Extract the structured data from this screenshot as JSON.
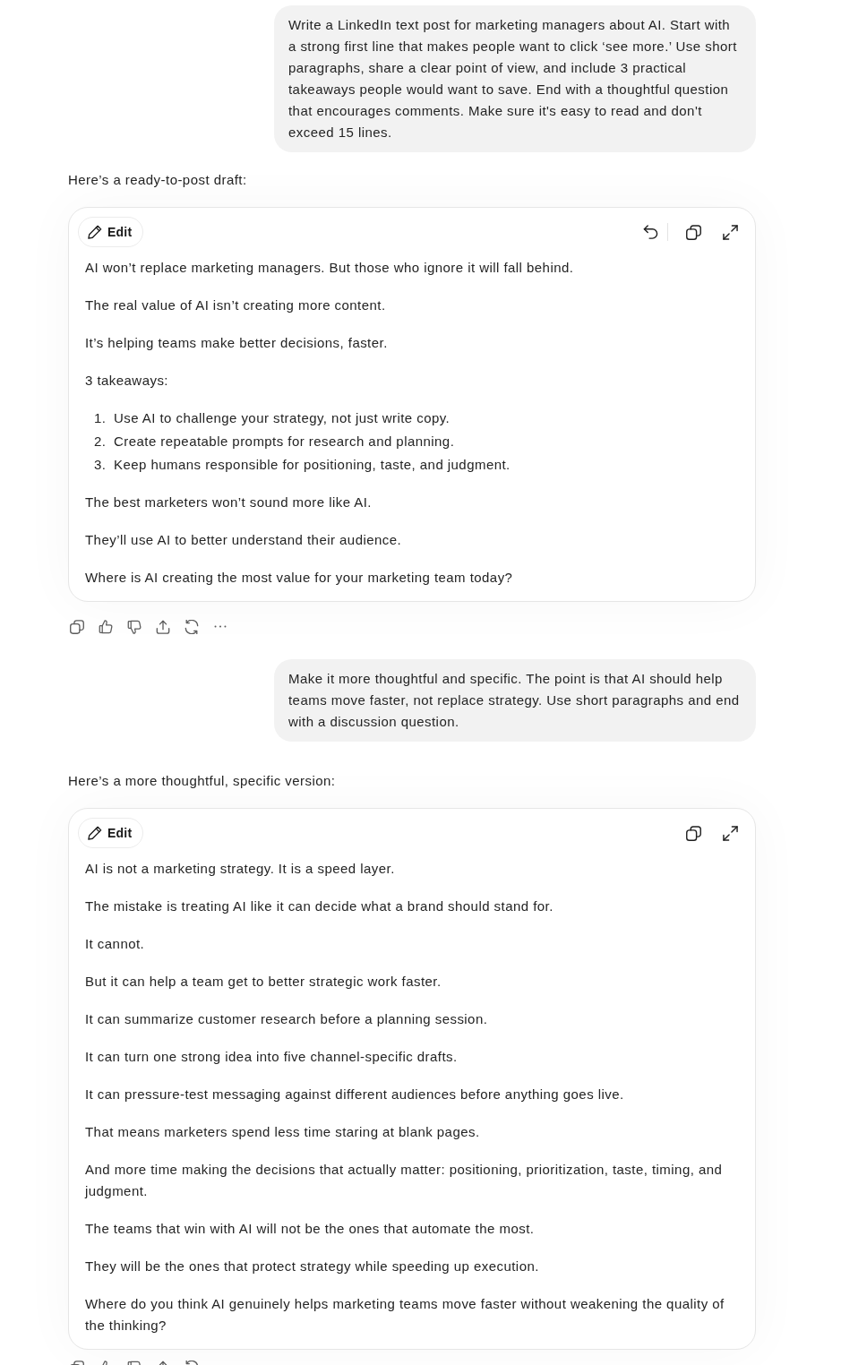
{
  "conversation": [
    {
      "kind": "user",
      "text": "Write a LinkedIn text post for marketing managers about AI. Start with a strong first line that makes people want to click ‘see more.’ Use short paragraphs, share a clear point of view, and include 3 practical takeaways people would want to save. End with a thoughtful question that encourages comments. Make sure it's easy to read and don't exceed 15 lines."
    },
    {
      "kind": "assistant",
      "intro": "Here’s a ready-to-post draft:",
      "draft": {
        "edit_label": "Edit",
        "undo_available": true,
        "blocks": [
          {
            "kind": "paragraph",
            "text": "AI won’t replace marketing managers. But those who ignore it will fall behind."
          },
          {
            "kind": "paragraph",
            "text": "The real value of AI isn’t creating more content."
          },
          {
            "kind": "paragraph",
            "text": "It’s helping teams make better decisions, faster."
          },
          {
            "kind": "paragraph",
            "text": "3 takeaways:"
          },
          {
            "kind": "numbered_list",
            "items": [
              {
                "number": "1.",
                "text": "Use AI to challenge your strategy, not just write copy."
              },
              {
                "number": "2.",
                "text": "Create repeatable prompts for research and planning."
              },
              {
                "number": "3.",
                "text": "Keep humans responsible for positioning, taste, and judgment."
              }
            ]
          },
          {
            "kind": "paragraph",
            "text": "The best marketers won’t sound more like AI."
          },
          {
            "kind": "paragraph",
            "text": "They’ll use AI to better understand their audience."
          },
          {
            "kind": "paragraph",
            "text": "Where is AI creating the most value for your marketing team today?"
          }
        ]
      }
    },
    {
      "kind": "user",
      "text": "Make it more thoughtful and specific. The point is that AI should help teams move faster, not replace strategy. Use short paragraphs and end with a discussion question."
    },
    {
      "kind": "assistant",
      "intro": "Here’s a more thoughtful, specific version:",
      "draft": {
        "edit_label": "Edit",
        "undo_available": false,
        "blocks": [
          {
            "kind": "paragraph",
            "text": "AI is not a marketing strategy. It is a speed layer."
          },
          {
            "kind": "paragraph",
            "text": "The mistake is treating AI like it can decide what a brand should stand for."
          },
          {
            "kind": "paragraph",
            "text": "It cannot."
          },
          {
            "kind": "paragraph",
            "text": "But it can help a team get to better strategic work faster."
          },
          {
            "kind": "paragraph",
            "text": "It can summarize customer research before a planning session."
          },
          {
            "kind": "paragraph",
            "text": "It can turn one strong idea into five channel-specific drafts."
          },
          {
            "kind": "paragraph",
            "text": "It can pressure-test messaging against different audiences before anything goes live."
          },
          {
            "kind": "paragraph",
            "text": "That means marketers spend less time staring at blank pages."
          },
          {
            "kind": "paragraph",
            "text": "And more time making the decisions that actually matter: positioning, prioritization, taste, timing, and judgment."
          },
          {
            "kind": "paragraph",
            "text": "The teams that win with AI will not be the ones that automate the most."
          },
          {
            "kind": "paragraph",
            "text": "They will be the ones that protect strategy while speeding up execution."
          },
          {
            "kind": "paragraph",
            "text": "Where do you think AI genuinely helps marketing teams move faster without weakening the quality of the thinking?"
          }
        ]
      }
    }
  ]
}
